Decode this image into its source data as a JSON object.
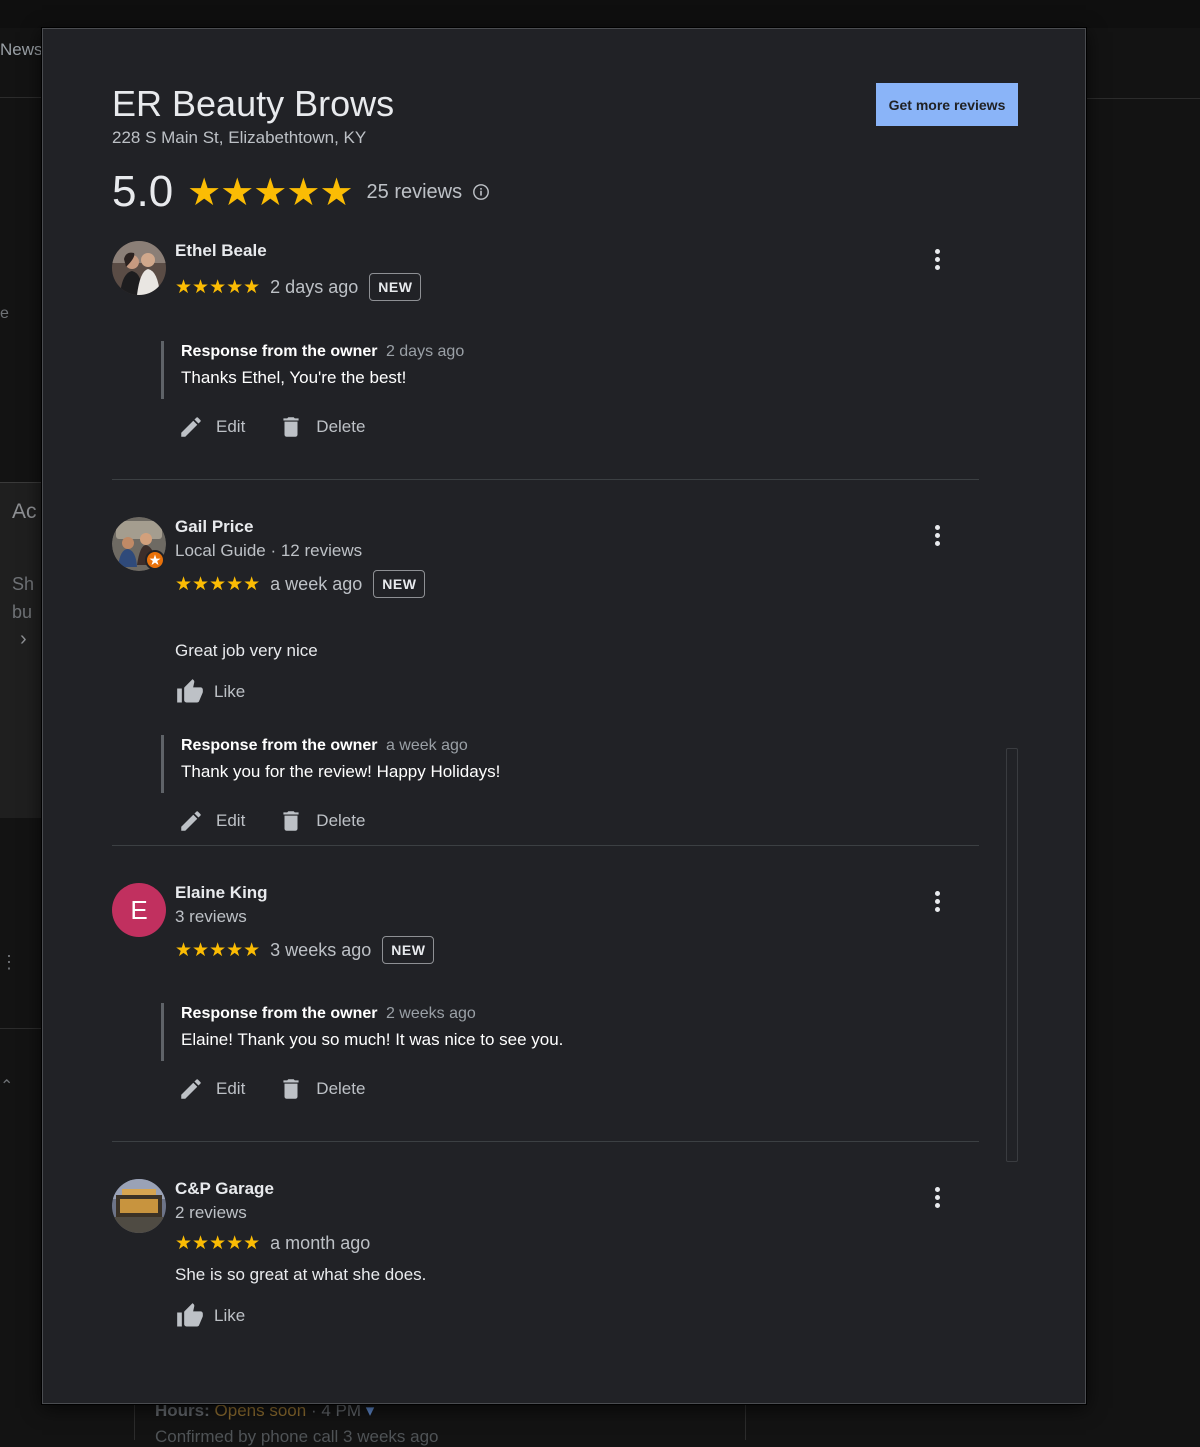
{
  "background": {
    "news_tab": "News",
    "left_title": "Ac",
    "left_line1": "Sh",
    "left_line2": "bu",
    "left_letter": "e",
    "hours_label": "Hours:",
    "hours_status": "Opens soon",
    "hours_time": "· 4 PM",
    "confirmed": "Confirmed by phone call 3 weeks ago"
  },
  "business": {
    "name": "ER Beauty Brows",
    "address": "228 S Main St, Elizabethtown, KY",
    "rating": "5.0",
    "rating_value": 5,
    "review_count": "25 reviews"
  },
  "actions": {
    "get_more_reviews": "Get more reviews"
  },
  "colors": {
    "star": "#fbbc04",
    "button_bg": "#8ab4f8",
    "dialog_bg": "#212226",
    "avatar_elaine": "#c1305f"
  },
  "reviews": [
    {
      "name": "Ethel Beale",
      "stars": "★★★★★",
      "time": "2 days ago",
      "badge": "NEW",
      "response": {
        "label": "Response from the owner",
        "time": "2 days ago",
        "text": "Thanks Ethel, You're the best!",
        "edit": "Edit",
        "delete": "Delete"
      }
    },
    {
      "name": "Gail Price",
      "subtitle": "Local Guide · 12 reviews",
      "stars": "★★★★★",
      "time": "a week ago",
      "badge": "NEW",
      "text": "Great job very nice",
      "like": "Like",
      "response": {
        "label": "Response from the owner",
        "time": "a week ago",
        "text": "Thank you for the review! Happy Holidays!",
        "edit": "Edit",
        "delete": "Delete"
      }
    },
    {
      "name": "Elaine King",
      "initial": "E",
      "subtitle": "3 reviews",
      "stars": "★★★★★",
      "time": "3 weeks ago",
      "badge": "NEW",
      "response": {
        "label": "Response from the owner",
        "time": "2 weeks ago",
        "text": "Elaine! Thank you so much! It was nice to see you.",
        "edit": "Edit",
        "delete": "Delete"
      }
    },
    {
      "name": "C&P Garage",
      "subtitle": "2 reviews",
      "stars": "★★★★★",
      "time": "a month ago",
      "text": "She is so great at what she does.",
      "like": "Like"
    }
  ]
}
